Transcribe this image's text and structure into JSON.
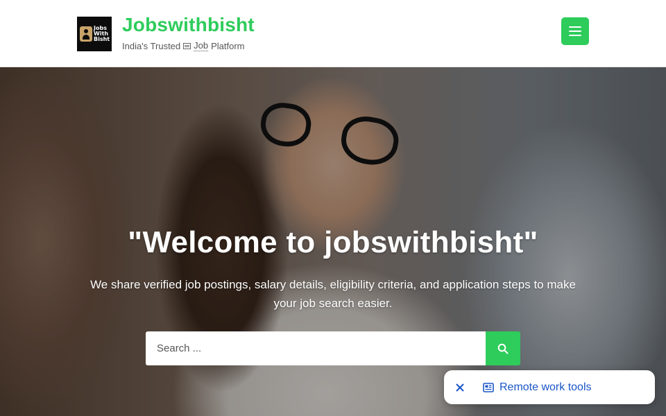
{
  "header": {
    "logo_lines": [
      "Jobs",
      "With",
      "Bisht"
    ],
    "site_title": "Jobswithbisht",
    "tagline_before": "India's Trusted",
    "tagline_job": "Job",
    "tagline_after": "Platform",
    "menu_icon": "hamburger-menu-icon"
  },
  "hero": {
    "title": "\"Welcome to jobswithbisht\"",
    "subtitle": "We share verified job postings, salary details, eligibility criteria, and application steps to make your job search easier.",
    "search": {
      "placeholder": "Search ...",
      "value": "",
      "button_icon": "search-icon"
    }
  },
  "chip": {
    "close_icon": "close-icon",
    "link_icon": "newspaper-icon",
    "link_label": "Remote work tools"
  },
  "colors": {
    "brand_green": "#2ecc5b",
    "chip_link_blue": "#1a56c8"
  }
}
